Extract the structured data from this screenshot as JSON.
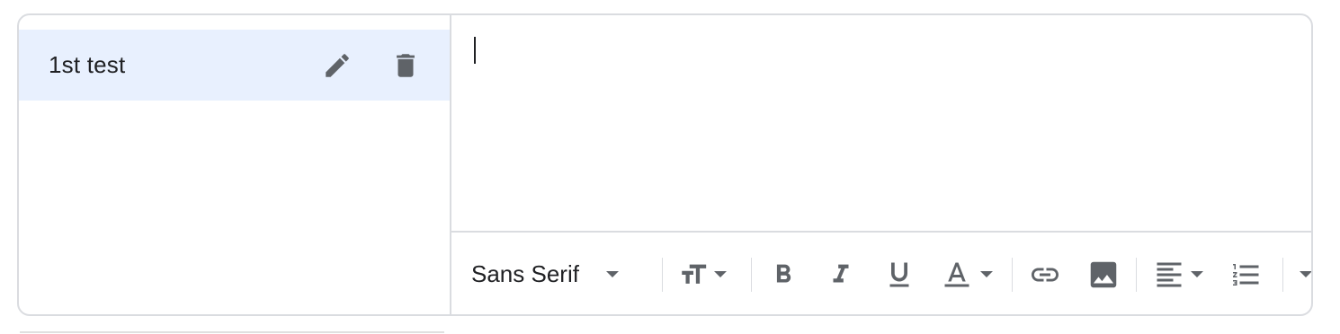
{
  "templates": {
    "items": [
      {
        "label": "1st test",
        "edit_icon": "pencil-icon",
        "delete_icon": "trash-icon"
      }
    ]
  },
  "toolbar": {
    "font_family": "Sans Serif",
    "icons": [
      "text-size-icon",
      "bold-icon",
      "italic-icon",
      "underline-icon",
      "text-color-icon",
      "link-icon",
      "image-icon",
      "align-left-icon",
      "numbered-list-icon",
      "more-formatting-icon"
    ]
  },
  "colors": {
    "selected_bg": "#e8f0fe",
    "icon": "#5f6368",
    "border": "#dadce0"
  }
}
